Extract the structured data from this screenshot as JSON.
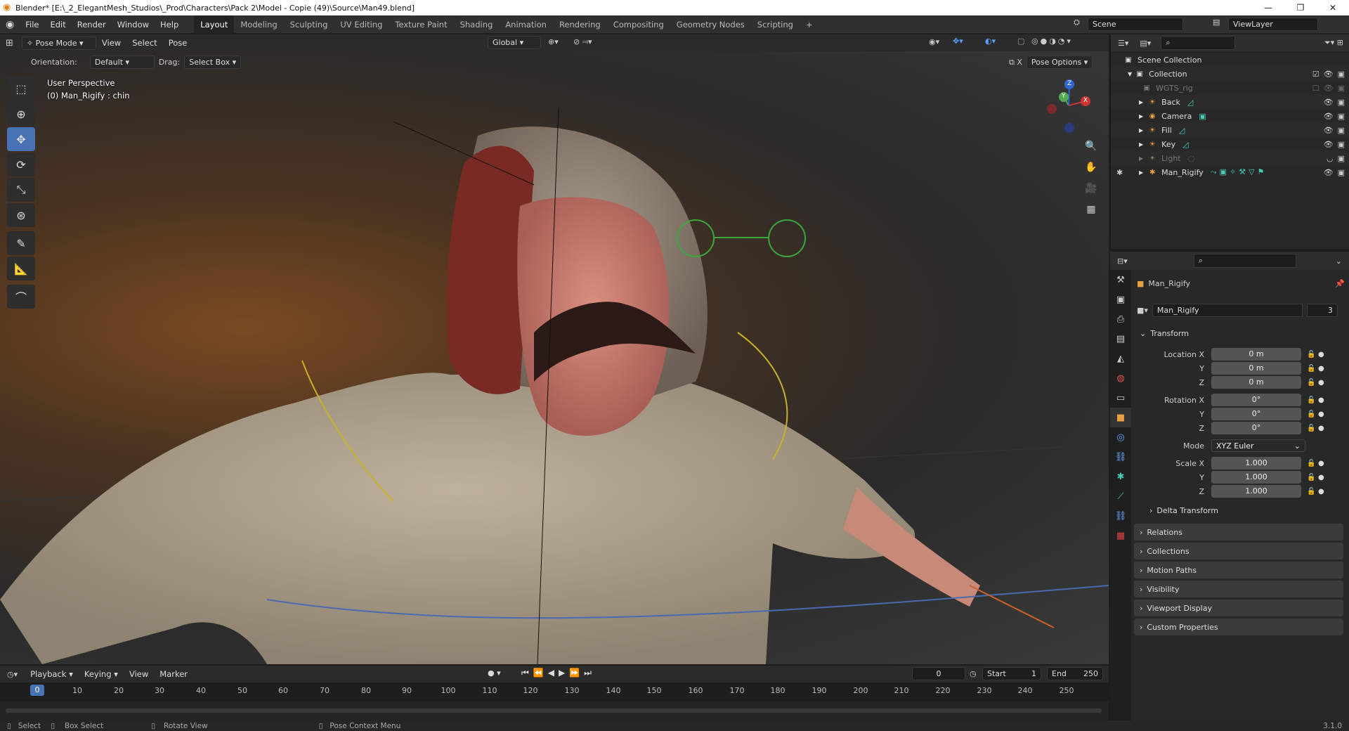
{
  "window": {
    "title": "Blender* [E:\\_2_ElegantMesh_Studios\\_Prod\\Characters\\Pack 2\\Model - Copie (49)\\Source\\Man49.blend]",
    "controls": [
      "—",
      "❐",
      "✕"
    ]
  },
  "menubar": {
    "items": [
      "File",
      "Edit",
      "Render",
      "Window",
      "Help"
    ],
    "workspaces": [
      "Layout",
      "Modeling",
      "Sculpting",
      "UV Editing",
      "Texture Paint",
      "Shading",
      "Animation",
      "Rendering",
      "Compositing",
      "Geometry Nodes",
      "Scripting",
      "+"
    ],
    "active_workspace": "Layout",
    "scene": "Scene",
    "view_layer": "ViewLayer"
  },
  "viewport_header": {
    "mode": "Pose Mode",
    "menus": [
      "View",
      "Select",
      "Pose"
    ],
    "transform_orientation": "Global",
    "orientation_label": "Orientation:",
    "orientation_value": "Default",
    "drag_label": "Drag:",
    "drag_value": "Select Box",
    "pose_options": "Pose Options"
  },
  "viewport": {
    "perspective": "User Perspective",
    "active_bone": "(0) Man_Rigify : chin",
    "gizmo_axes": [
      "X",
      "Y",
      "Z"
    ]
  },
  "outliner": {
    "root": "Scene Collection",
    "collection": "Collection",
    "items": [
      {
        "name": "WGTS_rig",
        "dim": true
      },
      {
        "name": "Back",
        "dim": false
      },
      {
        "name": "Camera",
        "dim": false
      },
      {
        "name": "Fill",
        "dim": false
      },
      {
        "name": "Key",
        "dim": false
      },
      {
        "name": "Light",
        "dim": true
      },
      {
        "name": "Man_Rigify",
        "dim": false
      }
    ]
  },
  "properties": {
    "object_name": "Man_Rigify",
    "data_name": "Man_Rigify",
    "users": "3",
    "transform_label": "Transform",
    "location": {
      "label": "Location X",
      "x": "0 m",
      "y": "0 m",
      "z": "0 m"
    },
    "rotation": {
      "label": "Rotation X",
      "x": "0°",
      "y": "0°",
      "z": "0°"
    },
    "mode_label": "Mode",
    "mode_value": "XYZ Euler",
    "scale": {
      "label": "Scale X",
      "x": "1.000",
      "y": "1.000",
      "z": "1.000"
    },
    "axis_y": "Y",
    "axis_z": "Z",
    "delta": "Delta Transform",
    "panels": [
      "Relations",
      "Collections",
      "Motion Paths",
      "Visibility",
      "Viewport Display",
      "Custom Properties"
    ]
  },
  "timeline": {
    "menus": [
      "Playback",
      "Keying",
      "View",
      "Marker"
    ],
    "current_frame": "0",
    "start_label": "Start",
    "start": "1",
    "end_label": "End",
    "end": "250",
    "ticks": [
      "10",
      "20",
      "30",
      "40",
      "50",
      "60",
      "70",
      "80",
      "90",
      "100",
      "110",
      "120",
      "130",
      "140",
      "150",
      "160",
      "170",
      "180",
      "190",
      "200",
      "210",
      "220",
      "230",
      "240",
      "250"
    ],
    "playhead": "0"
  },
  "statusbar": {
    "items": [
      "Select",
      "Box Select",
      "Rotate View",
      "Pose Context Menu"
    ],
    "version": "3.1.0"
  }
}
